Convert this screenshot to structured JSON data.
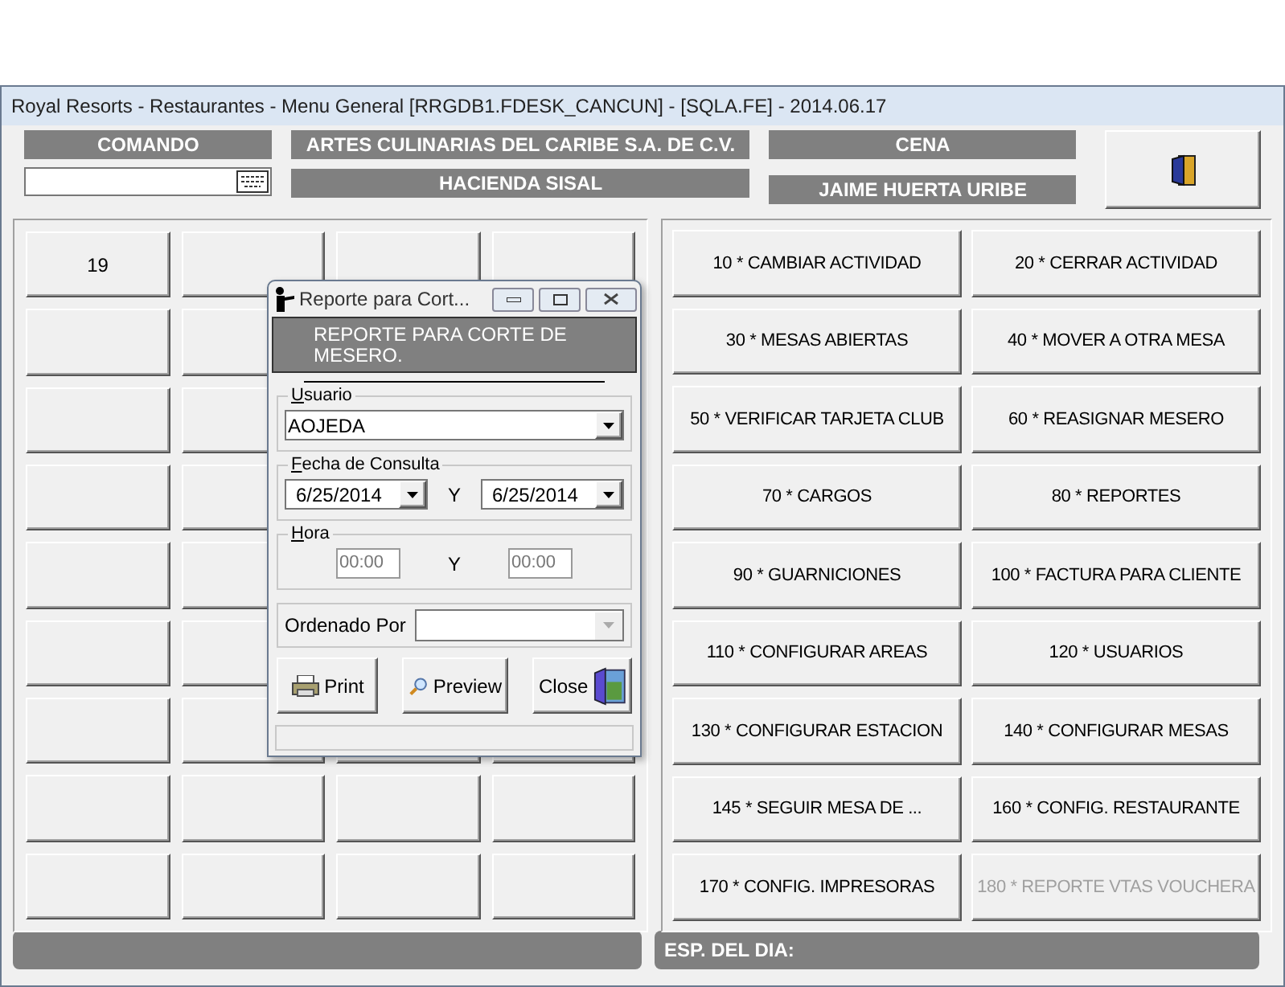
{
  "window": {
    "title": "Royal Resorts - Restaurantes - Menu General [RRGDB1.FDESK_CANCUN] - [SQLA.FE] - 2014.06.17"
  },
  "header": {
    "command_label": "COMANDO",
    "company": "ARTES CULINARIAS DEL CARIBE S.A. DE C.V.",
    "restaurant": "HACIENDA SISAL",
    "meal": "CENA",
    "waiter": "JAIME HUERTA URIBE"
  },
  "tables": [
    {
      "label": "19"
    }
  ],
  "actions": [
    {
      "label": "10 * CAMBIAR ACTIVIDAD",
      "disabled": false
    },
    {
      "label": "20 * CERRAR ACTIVIDAD",
      "disabled": false
    },
    {
      "label": "30 * MESAS ABIERTAS",
      "disabled": false
    },
    {
      "label": "40 * MOVER A OTRA MESA",
      "disabled": false
    },
    {
      "label": "50 * VERIFICAR TARJETA CLUB",
      "disabled": false
    },
    {
      "label": "60 * REASIGNAR MESERO",
      "disabled": false
    },
    {
      "label": "70 * CARGOS",
      "disabled": false
    },
    {
      "label": "80 * REPORTES",
      "disabled": false
    },
    {
      "label": "90 * GUARNICIONES",
      "disabled": false
    },
    {
      "label": "100 * FACTURA PARA CLIENTE",
      "disabled": false
    },
    {
      "label": "110 * CONFIGURAR AREAS",
      "disabled": false
    },
    {
      "label": "120 * USUARIOS",
      "disabled": false
    },
    {
      "label": "130 * CONFIGURAR ESTACION",
      "disabled": false
    },
    {
      "label": "140 * CONFIGURAR MESAS",
      "disabled": false
    },
    {
      "label": "145 * SEGUIR MESA DE ...",
      "disabled": false
    },
    {
      "label": "160 * CONFIG. RESTAURANTE",
      "disabled": false
    },
    {
      "label": "170 * CONFIG. IMPRESORAS",
      "disabled": false
    },
    {
      "label": "180 * REPORTE VTAS VOUCHERA",
      "disabled": true
    }
  ],
  "dialog": {
    "title": "Reporte para Cort...",
    "banner": "REPORTE PARA CORTE DE MESERO.",
    "usuario": {
      "label": "Usuario",
      "value": "AOJEDA"
    },
    "fecha": {
      "label": "Fecha de Consulta",
      "from": "6/25/2014",
      "and": "Y",
      "to": "6/25/2014"
    },
    "hora": {
      "label": "Hora",
      "from": "00:00",
      "and": "Y",
      "to": "00:00"
    },
    "orden": {
      "label": "Ordenado Por"
    },
    "buttons": [
      {
        "label": "Print",
        "kind": "print"
      },
      {
        "label": "Preview",
        "kind": "preview"
      },
      {
        "label": "Close",
        "kind": "close"
      }
    ]
  },
  "status_bar": {
    "special": "ESP. DEL DIA:"
  }
}
